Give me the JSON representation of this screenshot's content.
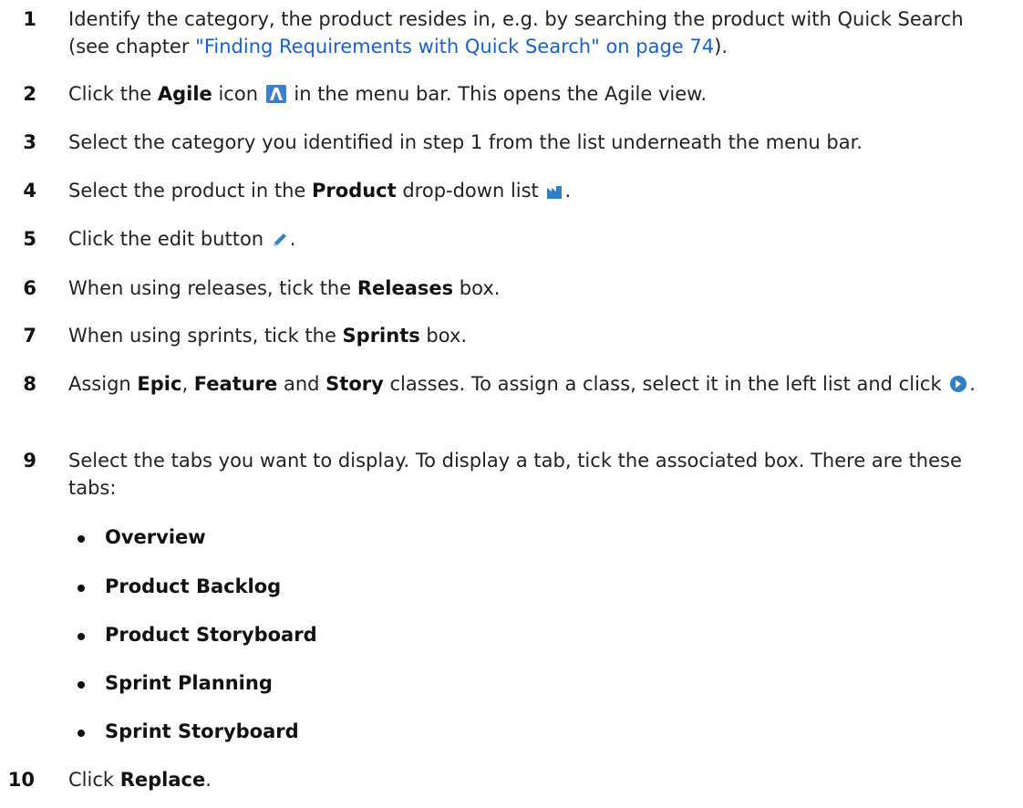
{
  "steps": [
    {
      "number": "1",
      "text_a": "Identify the category, the product resides in, e.g. by searching the product with Quick Search (see chapter ",
      "link": "\"Finding Requirements with Quick Search\" on page 74",
      "text_b": ")."
    },
    {
      "number": "2",
      "text_a": "Click the ",
      "bold": "Agile",
      "text_b": " icon ",
      "icon": "agile-icon",
      "text_c": " in the menu bar. This opens the Agile view."
    },
    {
      "number": "3",
      "text_a": "Select the category you identified in step 1 from the list underneath the menu bar."
    },
    {
      "number": "4",
      "text_a": "Select the product in the ",
      "bold": "Product",
      "text_b": " drop-down list ",
      "icon": "product-icon",
      "text_c": "."
    },
    {
      "number": "5",
      "text_a": "Click the edit button ",
      "icon": "edit-pencil-icon",
      "text_b": "."
    },
    {
      "number": "6",
      "text_a": "When using releases, tick the ",
      "bold": "Releases",
      "text_b": " box."
    },
    {
      "number": "7",
      "text_a": "When using sprints, tick the ",
      "bold": "Sprints",
      "text_b": " box."
    },
    {
      "number": "8",
      "text_a": "Assign ",
      "bold_a": "Epic",
      "text_b": ", ",
      "bold_b": "Feature",
      "text_c": " and ",
      "bold_c": "Story",
      "text_d": " classes. To assign a class, select it in the left list and click ",
      "icon": "assign-arrow-icon",
      "text_e": "."
    },
    {
      "number": "9",
      "text_a": "Select the tabs you want to display. To display a tab, tick the associated box. There are these tabs:",
      "tabs": [
        "Overview",
        "Product Backlog",
        "Product Storyboard",
        "Sprint Planning",
        "Sprint Storyboard"
      ]
    },
    {
      "number": "10",
      "text_a": "Click ",
      "bold": "Replace",
      "text_b": "."
    }
  ],
  "colors": {
    "text": "#222222",
    "link": "#1a5fd1",
    "icon_blue": "#2f80c8",
    "agile_icon_bg": "#3d7fcf"
  }
}
